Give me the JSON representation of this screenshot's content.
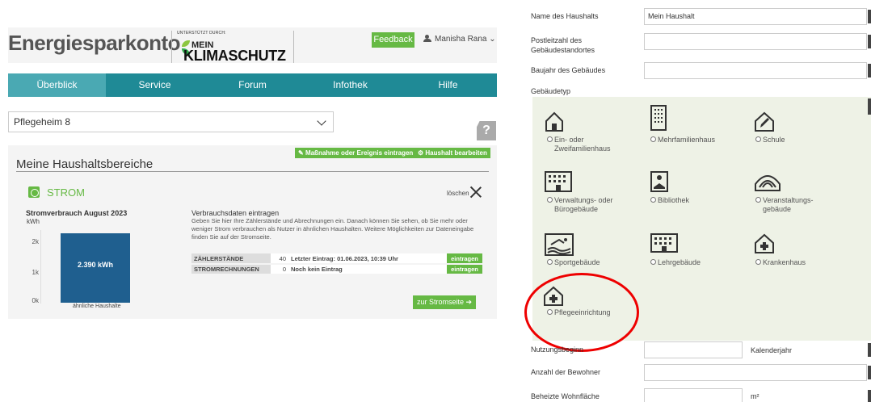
{
  "app": {
    "logo": "Energiesparkonto",
    "sponsor_small": "UNTERSTÜTZT DURCH:",
    "sponsor_mein": "MEIN",
    "sponsor_klima": "KLIMASCHUTZ",
    "feedback": "Feedback",
    "user": "Manisha Rana"
  },
  "nav": [
    "Überblick",
    "Service",
    "Forum",
    "Infothek",
    "Hilfe"
  ],
  "household_select": "Pflegeheim 8",
  "help_label": "?",
  "buttons": {
    "massnahme": "Maßnahme oder Ereignis eintragen",
    "haushalt": "Haushalt bearbeiten"
  },
  "section_title": "Meine Haushaltsbereiche",
  "strom": {
    "label": "STROM",
    "delete": "löschen",
    "chart_title": "Stromverbrauch August 2023",
    "unit": "kWh",
    "data_title": "Verbrauchsdaten eintragen",
    "data_text": "Geben Sie hier Ihre Zählerstände und Abrechnungen ein. Danach können Sie sehen, ob Sie mehr oder weniger Strom verbrauchen als Nutzer in ähnlichen Haushalten. Weitere Möglichkeiten zur Dateneingabe finden Sie auf der Stromseite.",
    "rows": [
      {
        "label": "ZÄHLERSTÄNDE",
        "count": "40",
        "entry": "Letzter Eintrag: 01.06.2023, 10:39 Uhr",
        "button": "eintragen"
      },
      {
        "label": "STROMRECHNUNGEN",
        "count": "0",
        "entry": "Noch kein Eintrag",
        "button": "eintragen"
      }
    ],
    "link": "zur Stromseite"
  },
  "chart_data": {
    "type": "bar",
    "title": "Stromverbrauch August 2023",
    "ylabel": "kWh",
    "categories": [
      "ähnliche Haushalte"
    ],
    "values": [
      2390
    ],
    "value_label": "2.390 kWh",
    "yticks": [
      "0k",
      "1k",
      "2k"
    ],
    "ylim": [
      0,
      2500
    ]
  },
  "form": {
    "name_label": "Name des Haushalts",
    "name_value": "Mein Haushalt",
    "plz_label": "Postleitzahl des Gebäudestandortes",
    "plz_value": "",
    "baujahr_label": "Baujahr des Gebäudes",
    "baujahr_value": "",
    "typ_label": "Gebäudetyp",
    "types": [
      "Ein- oder Zweifamilienhaus",
      "Mehrfamilienhaus",
      "Schule",
      "Verwaltungs- oder Bürogebäude",
      "Bibliothek",
      "Veranstaltungs- gebäude",
      "Sportgebäude",
      "Lehrgebäude",
      "Krankenhaus",
      "Pflegeeinrichtung"
    ],
    "nutzung_label": "Nutzungsbeginn",
    "nutzung_value": "",
    "nutzung_unit": "Kalenderjahr",
    "bewohner_label": "Anzahl der Bewohner",
    "bewohner_value": "",
    "flaeche_label": "Beheizte Wohnfläche",
    "flaeche_value": "",
    "flaeche_unit": "m²"
  }
}
